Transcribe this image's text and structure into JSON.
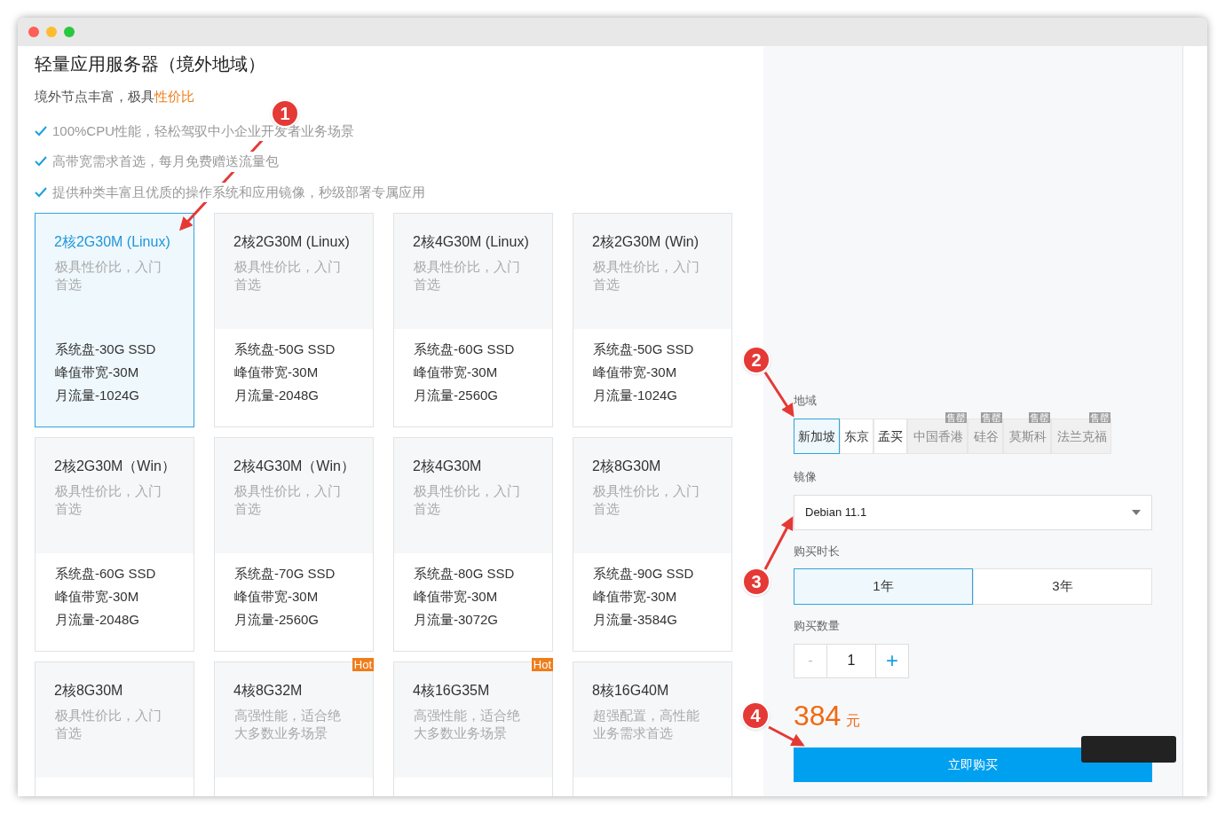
{
  "title": "轻量应用服务器（境外地域）",
  "subtitle": {
    "text": "境外节点丰富，极具",
    "highlight": "性价比"
  },
  "features": [
    "100%CPU性能，轻松驾驭中小企业开发者业务场景",
    "高带宽需求首选，每月免费赠送流量包",
    "提供种类丰富且优质的操作系统和应用镜像，秒级部署专属应用"
  ],
  "plans": [
    {
      "name": "2核2G30M (Linux)",
      "desc": "极具性价比，入门首选",
      "specs": [
        "系统盘-30G SSD",
        "峰值带宽-30M",
        "月流量-1024G"
      ],
      "selected": true
    },
    {
      "name": "2核2G30M (Linux)",
      "desc": "极具性价比，入门首选",
      "specs": [
        "系统盘-50G SSD",
        "峰值带宽-30M",
        "月流量-2048G"
      ],
      "selected": false
    },
    {
      "name": "2核4G30M (Linux)",
      "desc": "极具性价比，入门首选",
      "specs": [
        "系统盘-60G SSD",
        "峰值带宽-30M",
        "月流量-2560G"
      ],
      "selected": false
    },
    {
      "name": "2核2G30M (Win)",
      "desc": "极具性价比，入门首选",
      "specs": [
        "系统盘-50G SSD",
        "峰值带宽-30M",
        "月流量-1024G"
      ],
      "selected": false
    },
    {
      "name": "2核2G30M（Win）",
      "desc": "极具性价比，入门首选",
      "specs": [
        "系统盘-60G SSD",
        "峰值带宽-30M",
        "月流量-2048G"
      ],
      "selected": false
    },
    {
      "name": "2核4G30M（Win）",
      "desc": "极具性价比，入门首选",
      "specs": [
        "系统盘-70G SSD",
        "峰值带宽-30M",
        "月流量-2560G"
      ],
      "selected": false
    },
    {
      "name": "2核4G30M",
      "desc": "极具性价比，入门首选",
      "specs": [
        "系统盘-80G SSD",
        "峰值带宽-30M",
        "月流量-3072G"
      ],
      "selected": false
    },
    {
      "name": "2核8G30M",
      "desc": "极具性价比，入门首选",
      "specs": [
        "系统盘-90G SSD",
        "峰值带宽-30M",
        "月流量-3584G"
      ],
      "selected": false
    },
    {
      "name": "2核8G30M",
      "desc": "极具性价比，入门首选",
      "selected": false
    },
    {
      "name": "4核8G32M",
      "desc": "高强性能，适合绝大多数业务场景",
      "selected": false,
      "badge": "Hot"
    },
    {
      "name": "4核16G35M",
      "desc": "高强性能，适合绝大多数业务场景",
      "selected": false,
      "badge": "Hot"
    },
    {
      "name": "8核16G40M",
      "desc": "超强配置，高性能业务需求首选",
      "selected": false
    }
  ],
  "region": {
    "label": "地域",
    "options": [
      {
        "name": "新加坡",
        "selected": true,
        "sold_out": false
      },
      {
        "name": "东京",
        "selected": false,
        "sold_out": false
      },
      {
        "name": "孟买",
        "selected": false,
        "sold_out": false
      },
      {
        "name": "中国香港",
        "selected": false,
        "sold_out": true,
        "badge": "售罄"
      },
      {
        "name": "硅谷",
        "selected": false,
        "sold_out": true,
        "badge": "售罄"
      },
      {
        "name": "莫斯科",
        "selected": false,
        "sold_out": true,
        "badge": "售罄"
      },
      {
        "name": "法兰克福",
        "selected": false,
        "sold_out": true,
        "badge": "售罄"
      }
    ]
  },
  "image": {
    "label": "镜像",
    "value": "Debian 11.1"
  },
  "duration": {
    "label": "购买时长",
    "options": [
      {
        "name": "1年",
        "selected": true
      },
      {
        "name": "3年",
        "selected": false
      }
    ]
  },
  "quantity": {
    "label": "购买数量",
    "minus": "-",
    "value": "1",
    "plus": "+"
  },
  "price": {
    "amount": "384",
    "unit": "元"
  },
  "buy_button": "立即购买",
  "annotations": [
    "1",
    "2",
    "3",
    "4"
  ]
}
